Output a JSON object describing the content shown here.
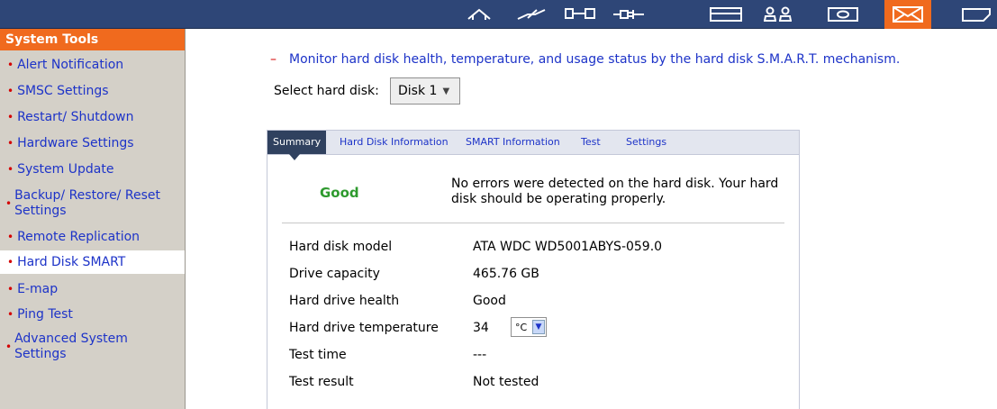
{
  "topbar": {
    "icons": [
      "home-icon",
      "lightning-icon",
      "network-icon",
      "plug-icon",
      "disk-icon",
      "users-icon",
      "monitor-icon",
      "mail-icon",
      "tag-icon"
    ],
    "active_icon": "mail-icon"
  },
  "sidebar": {
    "title": "System Tools",
    "items": [
      {
        "label": "Alert Notification"
      },
      {
        "label": "SMSC Settings"
      },
      {
        "label": "Restart/ Shutdown"
      },
      {
        "label": "Hardware Settings"
      },
      {
        "label": "System Update"
      },
      {
        "label": "Backup/ Restore/ Reset Settings"
      },
      {
        "label": "Remote Replication"
      },
      {
        "label": "Hard Disk SMART"
      },
      {
        "label": "E-map"
      },
      {
        "label": "Ping Test"
      },
      {
        "label": "Advanced System Settings"
      }
    ],
    "active_item": "Hard Disk SMART"
  },
  "main": {
    "description_dash": "–",
    "description": "Monitor hard disk health, temperature, and usage status by the hard disk S.M.A.R.T. mechanism.",
    "select_label": "Select hard disk:",
    "select_value": "Disk 1"
  },
  "tabs": [
    "Summary",
    "Hard Disk Information",
    "SMART Information",
    "Test",
    "Settings"
  ],
  "summary": {
    "health_status": "Good",
    "health_message": "No errors were detected on the hard disk. Your hard disk should be operating properly.",
    "rows": [
      {
        "label": "Hard disk model",
        "value": "ATA WDC WD5001ABYS-059.0"
      },
      {
        "label": "Drive capacity",
        "value": "465.76 GB"
      },
      {
        "label": "Hard drive health",
        "value": "Good"
      },
      {
        "label": "Hard drive temperature",
        "value": "34"
      },
      {
        "label": "Test time",
        "value": "---"
      },
      {
        "label": "Test result",
        "value": "Not tested"
      }
    ],
    "temp_unit": "°C"
  },
  "colors": {
    "topbar": "#2e4677",
    "accent_orange": "#f06a1e",
    "sidebar_bg": "#d4d0c8",
    "link_blue": "#1d33c8",
    "good_green": "#2e9a2e"
  }
}
